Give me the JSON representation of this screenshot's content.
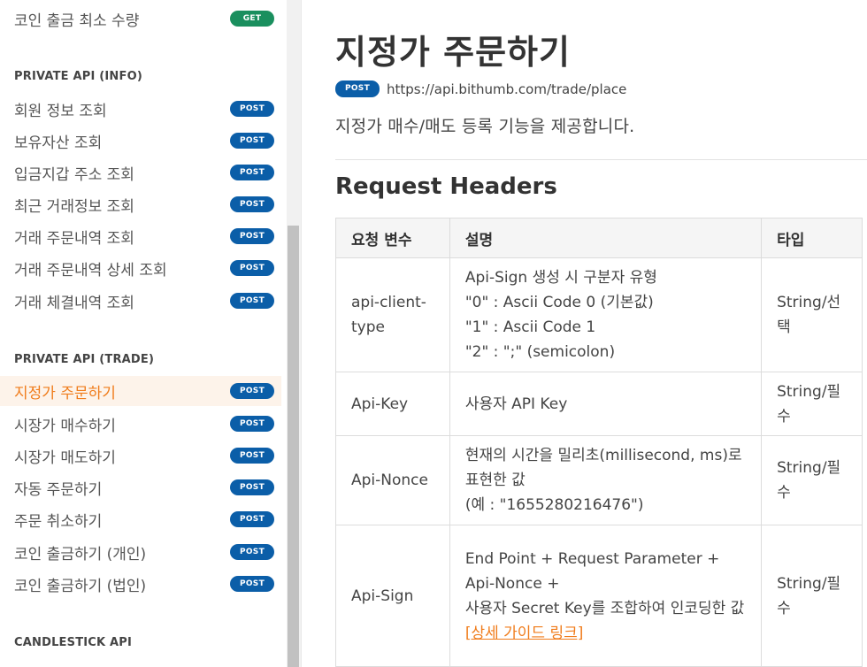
{
  "sidebar": {
    "top_item": {
      "label": "코인 출금 최소 수량",
      "method": "GET"
    },
    "sections": [
      {
        "title": "PRIVATE API (INFO)",
        "items": [
          {
            "label": "회원 정보 조회",
            "method": "POST"
          },
          {
            "label": "보유자산 조회",
            "method": "POST"
          },
          {
            "label": "입금지갑 주소 조회",
            "method": "POST"
          },
          {
            "label": "최근 거래정보 조회",
            "method": "POST"
          },
          {
            "label": "거래 주문내역 조회",
            "method": "POST"
          },
          {
            "label": "거래 주문내역 상세 조회",
            "method": "POST"
          },
          {
            "label": "거래 체결내역 조회",
            "method": "POST"
          }
        ]
      },
      {
        "title": "PRIVATE API (TRADE)",
        "items": [
          {
            "label": "지정가 주문하기",
            "method": "POST",
            "active": true
          },
          {
            "label": "시장가 매수하기",
            "method": "POST"
          },
          {
            "label": "시장가 매도하기",
            "method": "POST"
          },
          {
            "label": "자동 주문하기",
            "method": "POST"
          },
          {
            "label": "주문 취소하기",
            "method": "POST"
          },
          {
            "label": "코인 출금하기 (개인)",
            "method": "POST"
          },
          {
            "label": "코인 출금하기 (법인)",
            "method": "POST"
          }
        ]
      },
      {
        "title": "CANDLESTICK API",
        "items": []
      }
    ]
  },
  "main": {
    "title": "지정가 주문하기",
    "method": "POST",
    "url": "https://api.bithumb.com/trade/place",
    "description": "지정가 매수/매도 등록 기능을 제공합니다.",
    "section_heading": "Request Headers",
    "table": {
      "headers": [
        "요청 변수",
        "설명",
        "타입"
      ],
      "rows": [
        {
          "name": "api-client-type",
          "desc": [
            "Api-Sign 생성 시 구분자 유형",
            "\"0\" : Ascii Code 0 (기본값)",
            "\"1\" : Ascii Code 1",
            "\"2\" : \";\" (semicolon)"
          ],
          "type": "String/선택"
        },
        {
          "name": "Api-Key",
          "desc": [
            "사용자 API Key"
          ],
          "type": "String/필수"
        },
        {
          "name": "Api-Nonce",
          "desc": [
            "현재의 시간을 밀리초(millisecond, ms)로 표현한 값",
            "(예 : \"1655280216476\")"
          ],
          "type": "String/필수"
        },
        {
          "name": "Api-Sign",
          "desc": [
            "End Point + Request Parameter + Api-Nonce +",
            "사용자 Secret Key를 조합하여 인코딩한 값"
          ],
          "link": "[상세 가이드 링크]",
          "type": "String/필수"
        }
      ]
    }
  },
  "colors": {
    "accent": "#f07c1b",
    "post_badge": "#0b5ea8",
    "get_badge": "#1a8f5e",
    "active_bg": "#fdf3ea"
  }
}
